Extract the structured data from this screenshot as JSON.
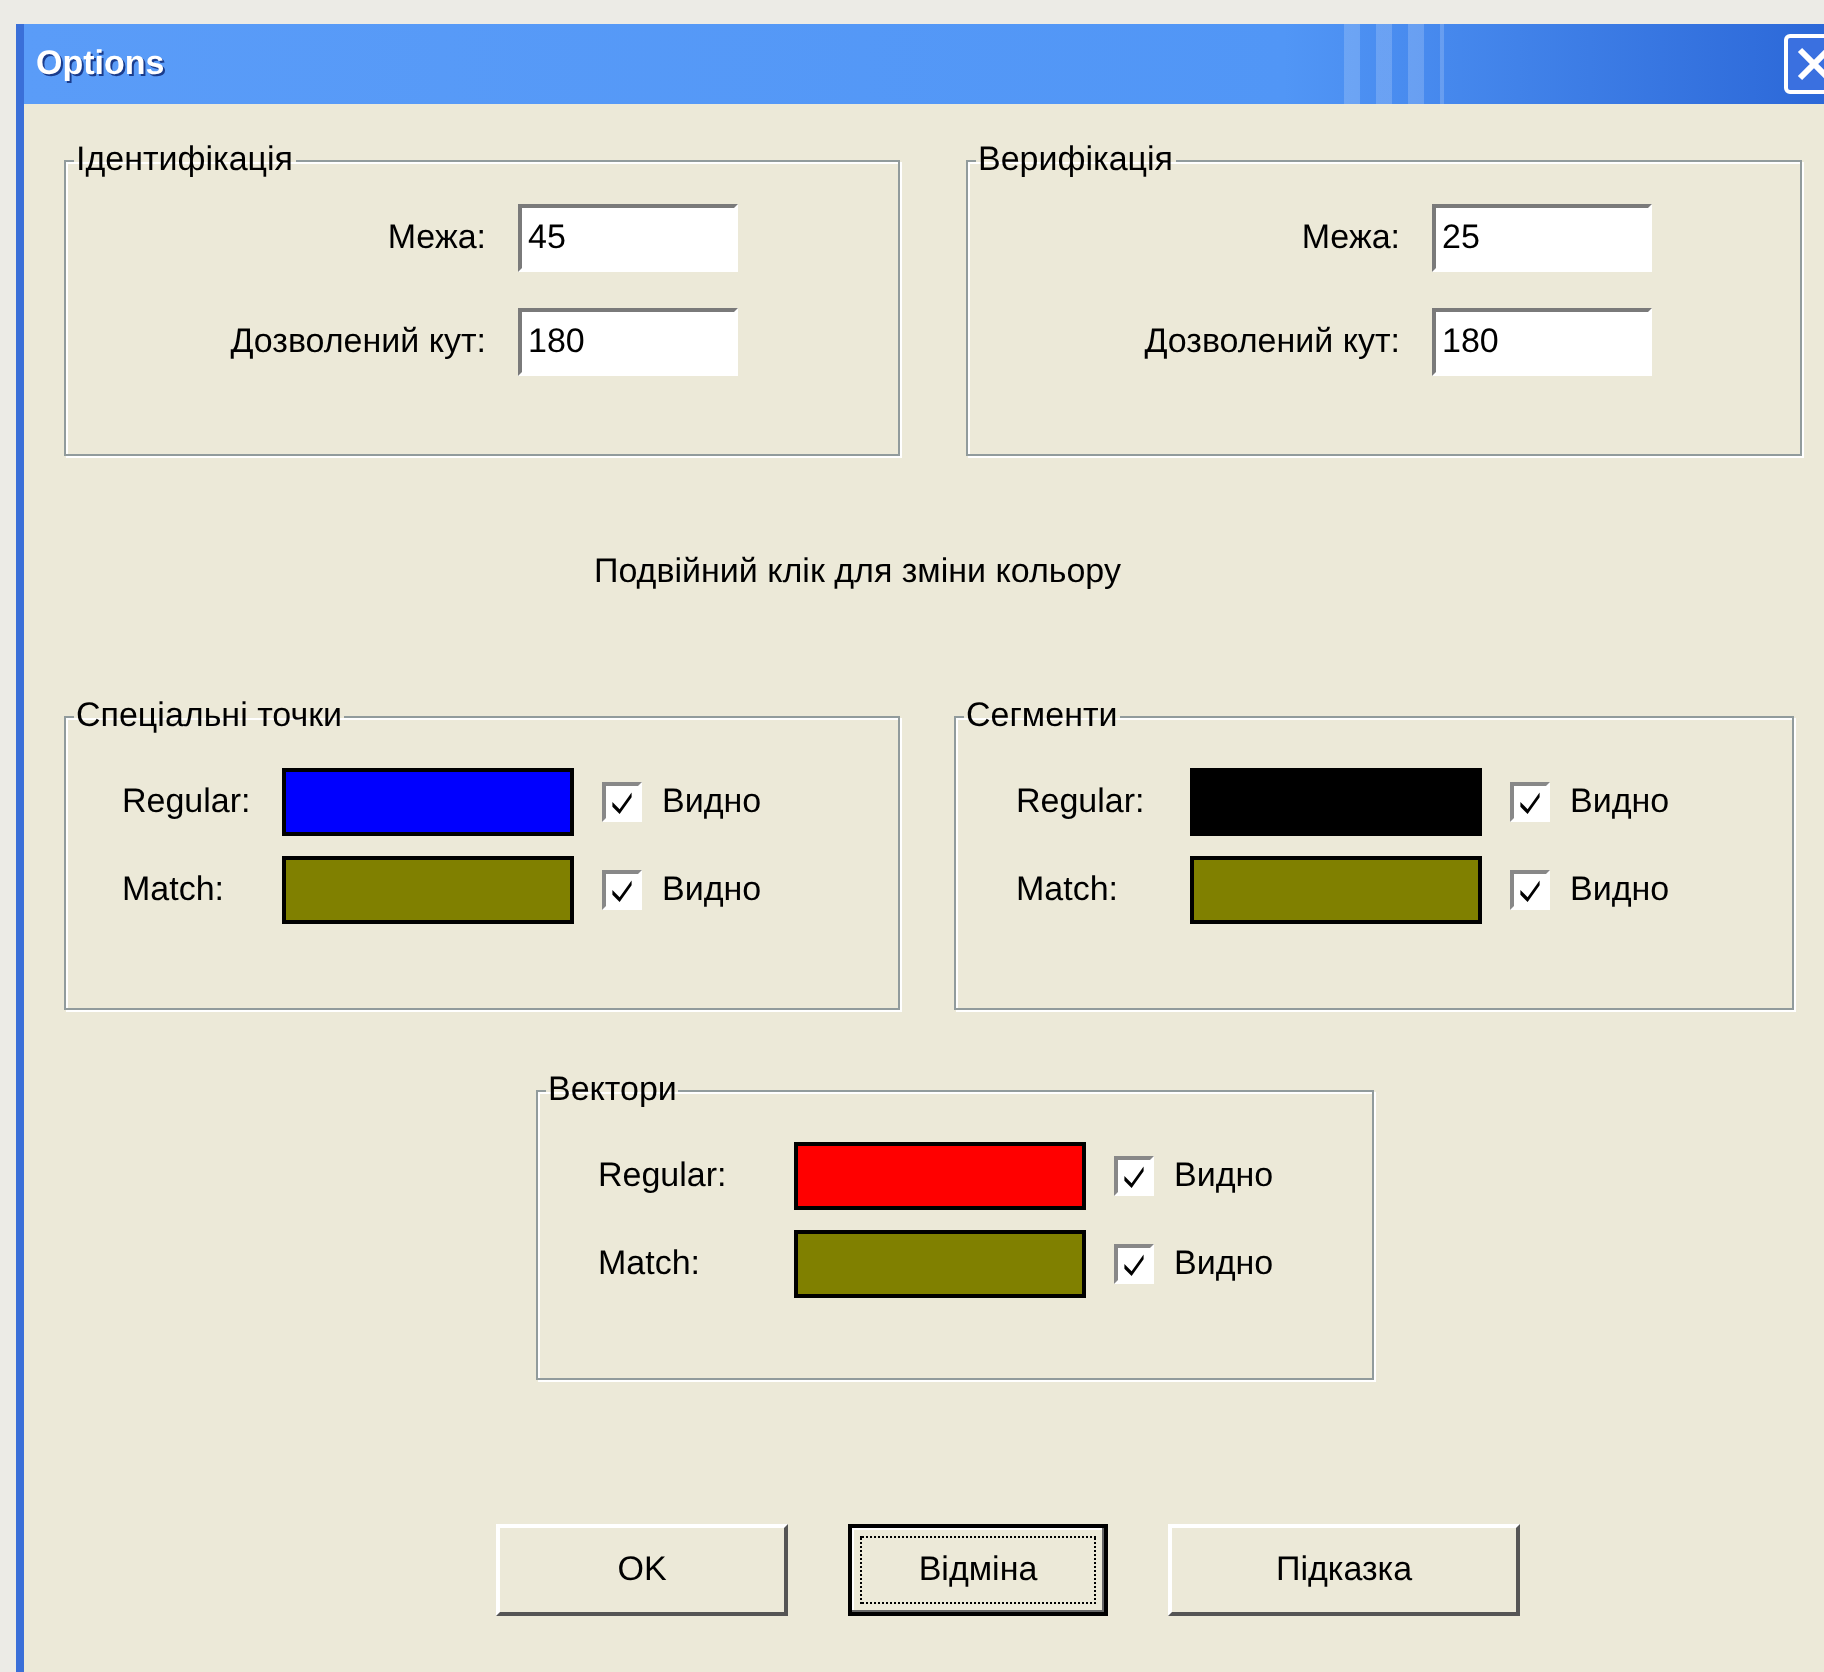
{
  "window": {
    "title": "Options"
  },
  "groups_top": [
    {
      "title": "Ідентифікація",
      "fields": [
        {
          "label": "Межа:",
          "value": "45"
        },
        {
          "label": "Дозволений кут:",
          "value": "180"
        }
      ]
    },
    {
      "title": "Верифікація",
      "fields": [
        {
          "label": "Межа:",
          "value": "25"
        },
        {
          "label": "Дозволений кут:",
          "value": "180"
        }
      ]
    }
  ],
  "hint": "Подвійний клік для зміни кольору",
  "color_groups": [
    {
      "title": "Спеціальні точки",
      "rows": [
        {
          "label": "Regular:",
          "color": "#0000ff",
          "checked": true,
          "check_label": "Видно"
        },
        {
          "label": "Match:",
          "color": "#808000",
          "checked": true,
          "check_label": "Видно"
        }
      ]
    },
    {
      "title": "Сегменти",
      "rows": [
        {
          "label": "Regular:",
          "color": "#000000",
          "checked": true,
          "check_label": "Видно"
        },
        {
          "label": "Match:",
          "color": "#808000",
          "checked": true,
          "check_label": "Видно"
        }
      ]
    },
    {
      "title": "Вектори",
      "rows": [
        {
          "label": "Regular:",
          "color": "#ff0000",
          "checked": true,
          "check_label": "Видно"
        },
        {
          "label": "Match:",
          "color": "#808000",
          "checked": true,
          "check_label": "Видно"
        }
      ]
    }
  ],
  "buttons": [
    {
      "label": "OK",
      "focused": false
    },
    {
      "label": "Відміна",
      "focused": true
    },
    {
      "label": "Підказка",
      "focused": false
    }
  ]
}
